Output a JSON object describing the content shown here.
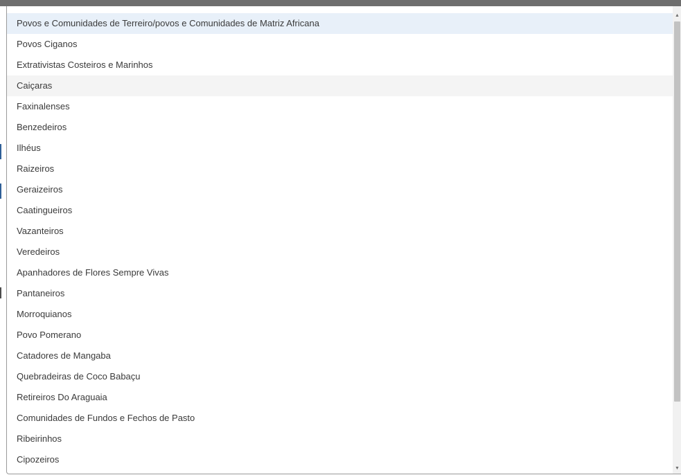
{
  "dropdown": {
    "options": [
      {
        "label": "Povos e Comunidades de Terreiro/povos e Comunidades de Matriz Africana",
        "state": "focused"
      },
      {
        "label": "Povos Ciganos",
        "state": "default"
      },
      {
        "label": "Extrativistas Costeiros e Marinhos",
        "state": "default"
      },
      {
        "label": "Caiçaras",
        "state": "hovered"
      },
      {
        "label": "Faxinalenses",
        "state": "default"
      },
      {
        "label": "Benzedeiros",
        "state": "default"
      },
      {
        "label": "Ilhéus",
        "state": "default"
      },
      {
        "label": "Raizeiros",
        "state": "default"
      },
      {
        "label": "Geraizeiros",
        "state": "default"
      },
      {
        "label": "Caatingueiros",
        "state": "default"
      },
      {
        "label": "Vazanteiros",
        "state": "default"
      },
      {
        "label": "Veredeiros",
        "state": "default"
      },
      {
        "label": "Apanhadores de Flores Sempre Vivas",
        "state": "default"
      },
      {
        "label": "Pantaneiros",
        "state": "default"
      },
      {
        "label": "Morroquianos",
        "state": "default"
      },
      {
        "label": "Povo Pomerano",
        "state": "default"
      },
      {
        "label": "Catadores de Mangaba",
        "state": "default"
      },
      {
        "label": "Quebradeiras de Coco Babaçu",
        "state": "default"
      },
      {
        "label": "Retireiros Do Araguaia",
        "state": "default"
      },
      {
        "label": "Comunidades de Fundos e Fechos de Pasto",
        "state": "default"
      },
      {
        "label": "Ribeirinhos",
        "state": "default"
      },
      {
        "label": "Cipozeiros",
        "state": "default"
      }
    ]
  },
  "scrollbar": {
    "up_icon": "scroll-up-arrow-icon",
    "down_icon": "scroll-down-arrow-icon",
    "up_glyph": "▲",
    "down_glyph": "▼"
  },
  "colors": {
    "focused_bg": "#e8f0f9",
    "hovered_bg": "#f4f4f4",
    "text": "#3a3a3a"
  }
}
